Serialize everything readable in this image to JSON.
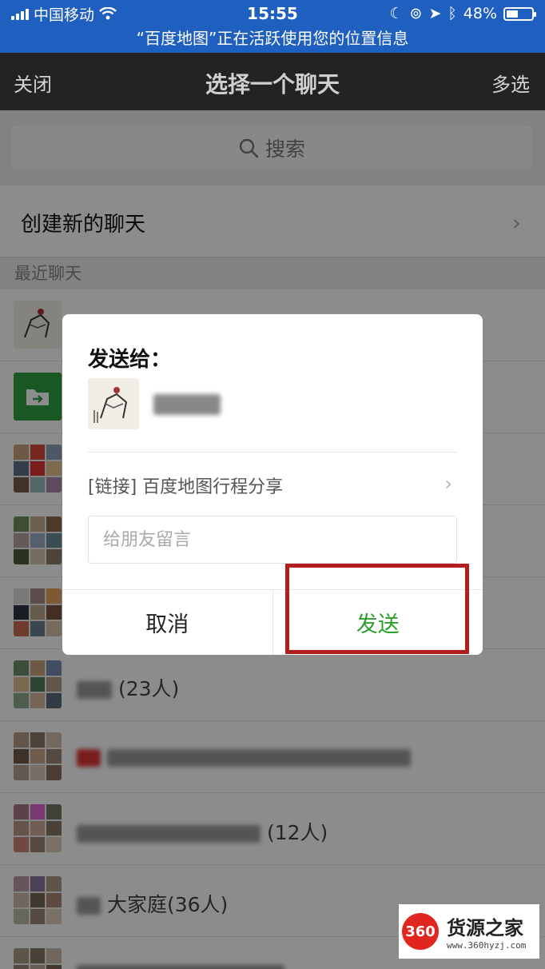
{
  "status_bar": {
    "carrier": "中国移动",
    "time": "15:55",
    "battery": "48%",
    "battery_level": 0.48,
    "location_banner": "“百度地图”正在活跃使用您的位置信息"
  },
  "nav": {
    "left": "关闭",
    "title": "选择一个聊天",
    "right": "多选"
  },
  "search": {
    "placeholder": "搜索"
  },
  "new_chat": {
    "label": "创建新的聊天"
  },
  "recent_label": "最近聊天",
  "chats": [
    {
      "name": "",
      "avatar": "drawing"
    },
    {
      "name": "",
      "avatar": "file-transfer"
    },
    {
      "name": "",
      "avatar": "group"
    },
    {
      "name": "",
      "avatar": "group"
    },
    {
      "name": "",
      "avatar": "group"
    },
    {
      "name": "(23人)",
      "avatar": "group"
    },
    {
      "name": "",
      "avatar": "group"
    },
    {
      "name": "(12人)",
      "avatar": "group"
    },
    {
      "name": "大家庭(36人)",
      "avatar": "group"
    },
    {
      "name": "",
      "avatar": "group"
    }
  ],
  "dialog": {
    "title": "发送给：",
    "link_text": "[链接] 百度地图行程分享",
    "message_placeholder": "给朋友留言",
    "cancel": "取消",
    "send": "发送"
  },
  "watermark": {
    "logo_text": "360",
    "brand": "货源之家",
    "url": "www.360hyzj.com"
  },
  "colors": {
    "status_bar": "#1f5fbf",
    "nav_bar": "#222325",
    "send_green": "#2aa12a",
    "highlight_red": "#b31d1d"
  }
}
